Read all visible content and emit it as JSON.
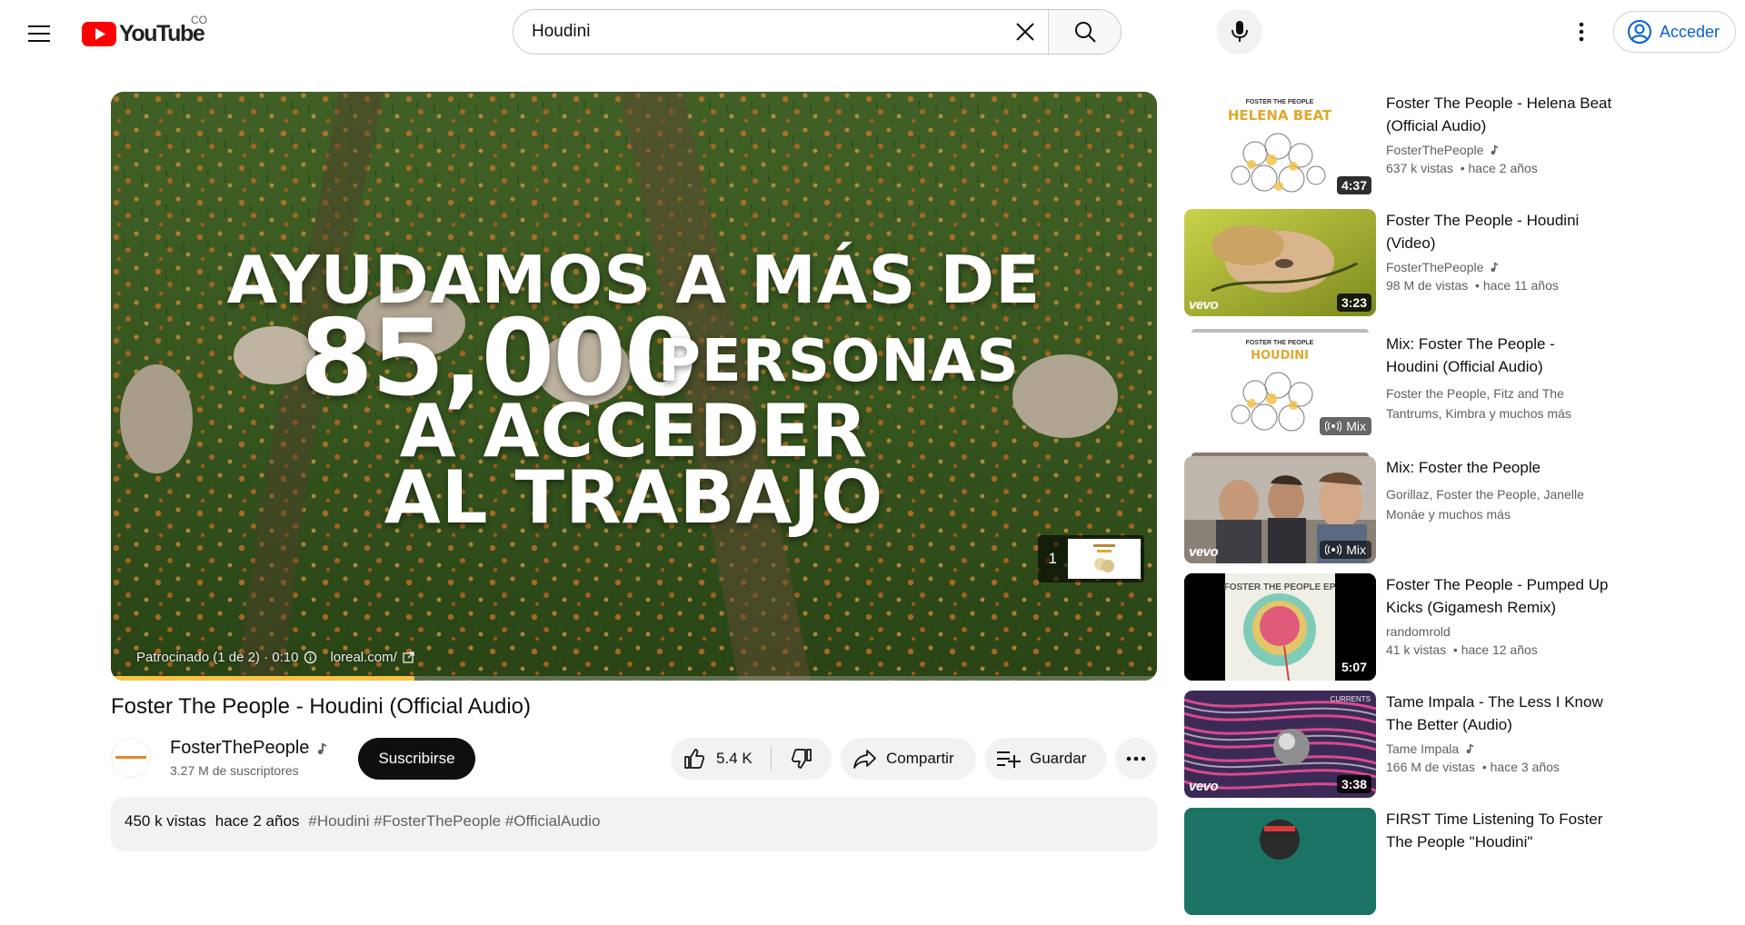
{
  "masthead": {
    "logo_text": "YouTube",
    "region": "CO",
    "search_value": "Houdini",
    "signin_label": "Acceder"
  },
  "player": {
    "ad_overlay": {
      "line1": "AYUDAMOS A MÁS DE",
      "big_number": "85,000",
      "line2_word": "PERSONAS",
      "line3": "A ACCEDER",
      "line4": "AL TRABAJO"
    },
    "ad_info": {
      "sponsored": "Patrocinado (1 de 2) · 0:10",
      "url": "loreal.com/"
    },
    "ad_queue_number": "1",
    "ad_progress": 0.29,
    "accent_color": "#f6c344"
  },
  "video": {
    "title": "Foster The People - Houdini (Official Audio)",
    "channel_name": "FosterThePeople",
    "subscribers": "3.27 M de suscriptores",
    "subscribe_label": "Suscribirse",
    "likes": "5.4 K",
    "share_label": "Compartir",
    "save_label": "Guardar",
    "views": "450 k vistas",
    "published": "hace 2 años",
    "hashtags": "#Houdini #FosterThePeople #OfficialAudio"
  },
  "recommendations": [
    {
      "title_line1": "Foster The People - Helena Beat",
      "title_line2": "(Official Audio)",
      "channel": "FosterThePeople",
      "verified_music": true,
      "views": "637 k vistas",
      "age": "hace 2 años",
      "duration": "4:37",
      "thumb": "helena"
    },
    {
      "title_line1": "Foster The People - Houdini",
      "title_line2": "(Video)",
      "channel": "FosterThePeople",
      "verified_music": true,
      "views": "98 M de vistas",
      "age": "hace 11 años",
      "duration": "3:23",
      "thumb": "houdini-video",
      "vevo": true
    },
    {
      "title_line1": "Mix: Foster The People -",
      "title_line2": "Houdini (Official Audio)",
      "multi_line1": "Foster the People, Fitz and The",
      "multi_line2": "Tantrums, Kimbra y muchos más",
      "badge": "Mix",
      "thumb": "mix-houdini"
    },
    {
      "title_line1": "Mix: Foster the People",
      "title_line2": "",
      "multi_line1": "Gorillaz, Foster the People, Janelle",
      "multi_line2": "Monáe y muchos más",
      "badge": "Mix",
      "thumb": "mix-ftp",
      "vevo": true
    },
    {
      "title_line1": "Foster The People - Pumped Up",
      "title_line2": "Kicks (Gigamesh Remix)",
      "channel": "randomrold",
      "views": "41 k vistas",
      "age": "hace 12 años",
      "duration": "5:07",
      "thumb": "pumped"
    },
    {
      "title_line1": "Tame Impala - The Less I Know",
      "title_line2": "The Better (Audio)",
      "channel": "Tame Impala",
      "verified_music": true,
      "views": "166 M de vistas",
      "age": "hace 3 años",
      "duration": "3:38",
      "thumb": "tame",
      "vevo": true
    },
    {
      "title_line1": "FIRST Time Listening To Foster",
      "title_line2": "The People \"Houdini\"",
      "thumb": "first"
    }
  ],
  "thumb_texts": {
    "helena_header": "FOSTER THE PEOPLE",
    "helena_title": "HELENA BEAT",
    "houdini_header": "FOSTER THE PEOPLE",
    "houdini_title": "HOUDINI",
    "pumped_header": "FOSTER THE PEOPLE EP",
    "tame_header": "CURRENTS",
    "vevo": "vevo"
  },
  "icons": [
    "menu-icon",
    "youtube-logo-icon",
    "clear-icon",
    "search-icon",
    "mic-icon",
    "more-vert-icon",
    "account-icon",
    "like-icon",
    "dislike-icon",
    "share-icon",
    "playlist-add-icon",
    "more-horiz-icon",
    "music-note-icon",
    "mix-icon",
    "info-icon",
    "external-link-icon"
  ]
}
